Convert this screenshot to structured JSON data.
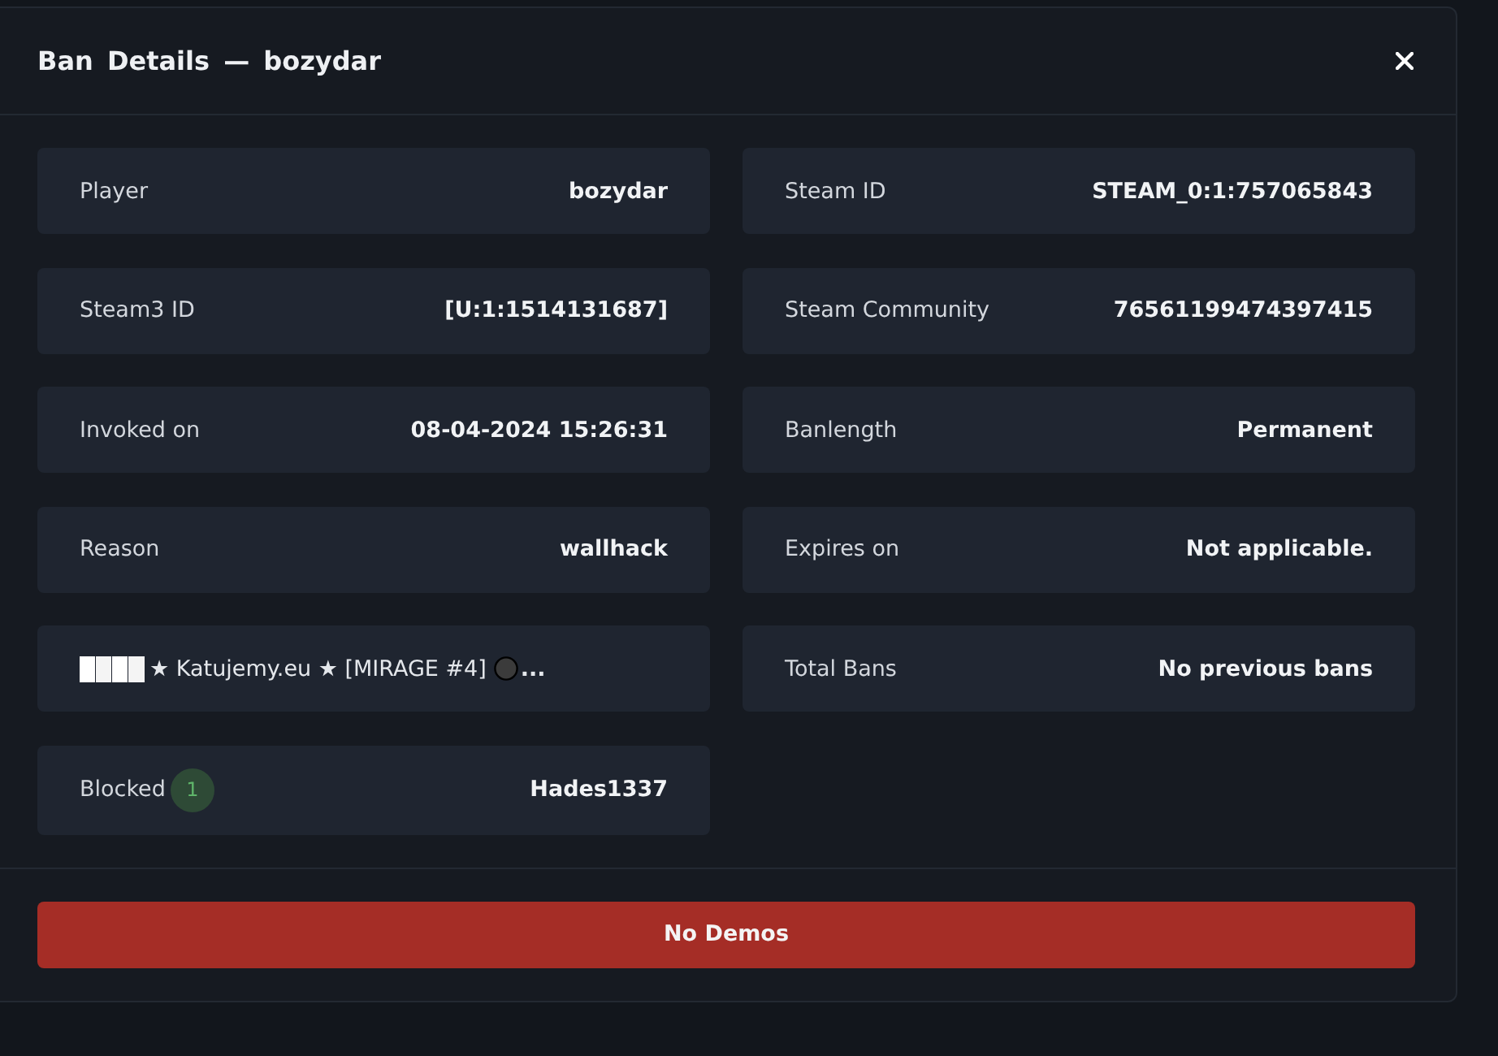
{
  "modal": {
    "title": "Ban Details — bozydar"
  },
  "fields": [
    {
      "kind": "pair",
      "label": "Player",
      "value": "bozydar"
    },
    {
      "kind": "pair",
      "label": "Steam ID",
      "value": "STEAM_0:1:757065843"
    },
    {
      "kind": "pair",
      "label": "Steam3 ID",
      "value": "[U:1:1514131687]"
    },
    {
      "kind": "pair",
      "label": "Steam Community",
      "value": "76561199474397415"
    },
    {
      "kind": "pair",
      "label": "Invoked on",
      "value": "08-04-2024 15:26:31"
    },
    {
      "kind": "pair",
      "label": "Banlength",
      "value": "Permanent"
    },
    {
      "kind": "pair",
      "label": "Reason",
      "value": "wallhack"
    },
    {
      "kind": "pair",
      "label": "Expires on",
      "value": "Not applicable."
    },
    {
      "kind": "server",
      "text": "★ Katujemy.eu ★ [MIRAGE #4]",
      "suffix": "..."
    },
    {
      "kind": "pair",
      "label": "Total Bans",
      "value": "No previous bans"
    },
    {
      "kind": "blocked",
      "label": "Blocked",
      "count": "1",
      "value": "Hades1337"
    }
  ],
  "footer": {
    "button": "No Demos"
  }
}
